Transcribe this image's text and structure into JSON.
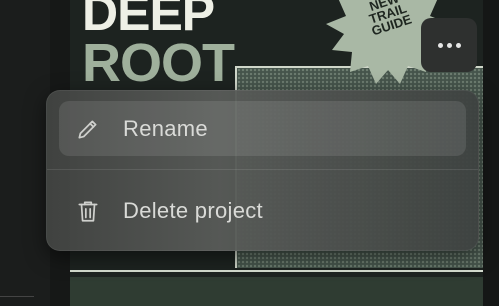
{
  "poster": {
    "title_line1": "DEEP",
    "title_line2": "ROOT",
    "badge": "NEW\nTRAIL\nGUIDE"
  },
  "more_button": {
    "icon": "ellipsis-icon"
  },
  "context_menu": {
    "items": [
      {
        "label": "Rename",
        "icon": "pencil-icon"
      },
      {
        "label": "Delete project",
        "icon": "trash-icon"
      }
    ]
  },
  "colors": {
    "background": "#141615",
    "menu": "#585b58",
    "poster": "#1d2320",
    "title_light": "#eef0e6",
    "title_green": "#9fb09c",
    "badge": "#a9b8a5"
  }
}
